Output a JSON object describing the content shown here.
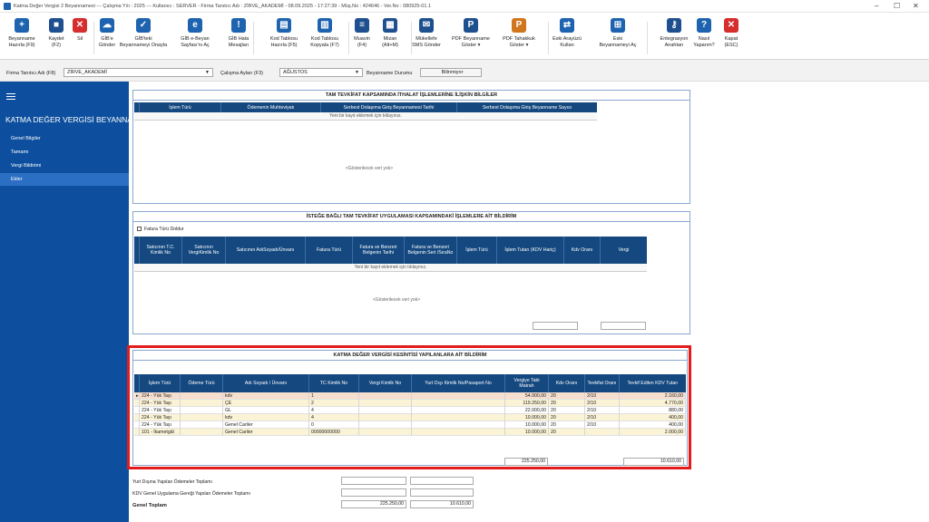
{
  "window": {
    "title": "Katma Değer Vergisi 2 Beyannamesi  ---  Çalışma Yılı : 2025  ---  Kullanıcı : SERVER - Firma Tanıtıcı Adı : ZİRVE_AKADEMİ - 08.09.2025 - 17:27:39 - Müş.No : 424646 - Ver.No : 080925-01.1"
  },
  "toolbar": [
    {
      "label": "Beyanname\nHazırla (F9)",
      "icon": "new-document-icon",
      "color": "#1e63b0"
    },
    {
      "label": "Kaydet\n(F2)",
      "icon": "save-icon",
      "color": "#1e4f8f"
    },
    {
      "label": "Sil",
      "icon": "delete-icon",
      "color": "#d62d2d"
    },
    {
      "label": "GİB'e\nGönder",
      "icon": "cloud-upload-icon",
      "color": "#1e63b0"
    },
    {
      "label": "GİB'teki\nBeyannameyi Onayla",
      "icon": "approve-icon",
      "color": "#1e63b0"
    },
    {
      "label": "GİB e-Beyan\nSayfası'nı Aç",
      "icon": "web-icon",
      "color": "#1e63b0"
    },
    {
      "label": "GİB Hata\nMesajları",
      "icon": "warning-icon",
      "color": "#1e63b0"
    },
    {
      "label": "Kod Tablosu\nHazırla (F5)",
      "icon": "table-edit-icon",
      "color": "#1e63b0"
    },
    {
      "label": "Kod Tablosu\nKopyala (F7)",
      "icon": "table-copy-icon",
      "color": "#1e63b0"
    },
    {
      "label": "Muavin\n(F4)",
      "icon": "list-icon",
      "color": "#1e4f8f"
    },
    {
      "label": "Mizan\n(Alt+M)",
      "icon": "grid-icon",
      "color": "#1e4f8f"
    },
    {
      "label": "Mükellefe\nSMS Gönder",
      "icon": "sms-icon",
      "color": "#1e4f8f"
    },
    {
      "label": "PDF Beyanname\nGöster ▾",
      "icon": "pdf-icon",
      "color": "#1e4f8f"
    },
    {
      "label": "PDF Tahakkuk\nGöster ▾",
      "icon": "pdf-orange-icon",
      "color": "#d0761e"
    },
    {
      "label": "Eski Arayüzü\nKullan",
      "icon": "switch-icon",
      "color": "#1e63b0"
    },
    {
      "label": "Eski\nBeyannameyi Aç",
      "icon": "open-old-icon",
      "color": "#1e63b0"
    },
    {
      "label": "Entegrasyon\nAnahtarı",
      "icon": "key-icon",
      "color": "#1e4f8f"
    },
    {
      "label": "Nasıl\nYaparım?",
      "icon": "help-icon",
      "color": "#1e63b0"
    },
    {
      "label": "Kapat\n(ESC)",
      "icon": "close-icon",
      "color": "#d62d2d"
    }
  ],
  "filters": {
    "firma_label": "Firma Tanıtıcı Adı (F8)",
    "firma_value": "ZİRVE_AKADEMİ",
    "ay_label": "Çalışma Ayları (F3)",
    "ay_value": "AĞUSTOS",
    "durum_label": "Beyanname Durumu",
    "durum_value": "Bilinmiyor"
  },
  "sidebar": {
    "title": "KATMA DEĞER VERGİSİ BEYANNAM...",
    "items": [
      "Genel Bilgiler",
      "Tamamı",
      "Vergi Bildirimi",
      "Ekler"
    ],
    "active": 3
  },
  "panel1": {
    "title": "TAM TEVKİFAT KAPSAMINDA İTHALAT İŞLEMLERİNE İLİŞKİN BİLGİLER",
    "columns": [
      "İşlem Türü",
      "Ödemenin Muhteviyatı",
      "Serbest Dolaşıma Giriş Beyannamesi Tarihi",
      "Serbest Dolaşıma Giriş Beyanname Sayısı"
    ],
    "new_row": "Yeni bir kayıt eklemek için tıklayınız.",
    "empty": "<Gösterilecek veri yok>"
  },
  "panel2": {
    "title": "İSTEĞE BAĞLI TAM TEVKİFAT UYGULAMASI KAPSAMINDAKİ İŞLEMLERE AİT BİLDİRİM",
    "checkbox": "Fatura Türü Doldur",
    "columns": [
      "Satıcının T.C. Kimlik No",
      "Satıcının VergiKimlik No",
      "Satıcının AdıSoyadı/Ünvanı",
      "Fatura Türü",
      "Fatura ve Benzeri Belgenin Tarihi",
      "Fatura ve Benzeri Belgenin Seri /SıraNo",
      "İşlem Türü",
      "İşlem Tutarı (KDV Hariç)",
      "Kdv Oranı",
      "Vergi"
    ],
    "new_row": "Yeni bir kayıt eklemek için tıklayınız.",
    "empty": "<Gösterilecek veri yok>"
  },
  "panel3": {
    "title": "KATMA DEĞER VERGİSİ KESİNTİSİ YAPILANLARA AİT BİLDİRİM",
    "columns": [
      "İşlem Türü",
      "Ödeme Türü",
      "Adı Soyadı / Ünvanı",
      "TC Kimlik No",
      "Vergi Kimlik No",
      "Yurt Dışı Kimlik No/Pasaport No",
      "Vergiye Tabi Matrah",
      "Kdv Oranı",
      "Tevkifat Oranı",
      "Tevkif Edilen KDV Tutarı"
    ],
    "rows": [
      {
        "islem": "224 - Yük Taşı",
        "odeme": "",
        "ad": "kdv",
        "tc": "1",
        "vkn": "",
        "yd": "",
        "matrah": "54.000,00",
        "kdv": "20",
        "tevkifat": "2/10",
        "tutar": "2.160,00"
      },
      {
        "islem": "224 - Yük Taşı",
        "odeme": "",
        "ad": "ÇE",
        "tc": "2",
        "vkn": "",
        "yd": "",
        "matrah": "119.250,00",
        "kdv": "20",
        "tevkifat": "2/10",
        "tutar": "4.770,00"
      },
      {
        "islem": "224 - Yük Taşı",
        "odeme": "",
        "ad": "GL",
        "tc": "4",
        "vkn": "",
        "yd": "",
        "matrah": "22.000,00",
        "kdv": "20",
        "tevkifat": "2/10",
        "tutar": "880,00"
      },
      {
        "islem": "224 - Yük Taşı",
        "odeme": "",
        "ad": "kdv",
        "tc": "4",
        "vkn": "",
        "yd": "",
        "matrah": "10.000,00",
        "kdv": "20",
        "tevkifat": "2/10",
        "tutar": "400,00"
      },
      {
        "islem": "224 - Yük Taşı",
        "odeme": "",
        "ad": "Genel Cariler",
        "tc": "0",
        "vkn": "",
        "yd": "",
        "matrah": "10.000,00",
        "kdv": "20",
        "tevkifat": "2/10",
        "tutar": "400,00"
      },
      {
        "islem": "101 - İkametgâl",
        "odeme": "",
        "ad": "Genel Cariler",
        "tc": "00000000000",
        "vkn": "",
        "yd": "",
        "matrah": "10.000,00",
        "kdv": "20",
        "tevkifat": "",
        "tutar": "2.000,00"
      }
    ],
    "total_matrah": "225.250,00",
    "total_tutar": "10.610,00"
  },
  "bottom": {
    "line1_label": "Yurt Dışına Yapılan Ödemeler Toplamı",
    "line2_label": "KDV Genel Uygulama Gereği Yapılan Ödemeler Toplamı",
    "total_label": "Genel Toplam",
    "total_matrah": "225.250,00",
    "total_tutar": "10.610,00"
  }
}
